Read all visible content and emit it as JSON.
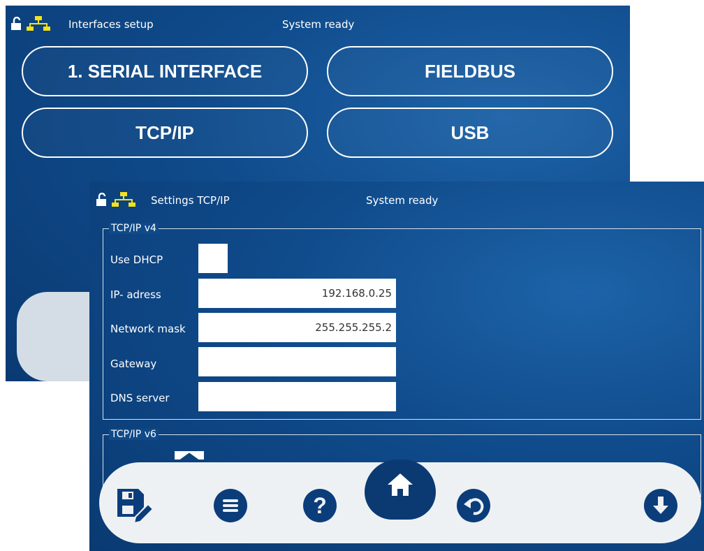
{
  "back_window": {
    "title": "Interfaces setup",
    "status": "System ready",
    "buttons": {
      "serial": "1. SERIAL INTERFACE",
      "fieldbus": "FIELDBUS",
      "tcpip": "TCP/IP",
      "usb": "USB"
    }
  },
  "front_window": {
    "title": "Settings TCP/IP",
    "status": "System ready",
    "ipv4": {
      "group_label": "TCP/IP v4",
      "use_dhcp_label": "Use DHCP",
      "use_dhcp_checked": false,
      "ip_label": "IP- adress",
      "ip_value": "192.168.0.25",
      "mask_label": "Network mask",
      "mask_value": "255.255.255.2",
      "gateway_label": "Gateway",
      "gateway_value": "",
      "dns_label": "DNS server",
      "dns_value": ""
    },
    "ipv6": {
      "group_label": "TCP/IP v6"
    }
  },
  "toolbar": {
    "icons": [
      "save-edit-icon",
      "menu-icon",
      "help-icon",
      "home-icon",
      "undo-icon",
      "download-icon"
    ]
  },
  "colors": {
    "panel_bg": "#0f4a8a",
    "accent_yellow": "#f2e21b",
    "toolbar_bg": "#eef1f4",
    "icon_fill": "#0b3d7a"
  }
}
